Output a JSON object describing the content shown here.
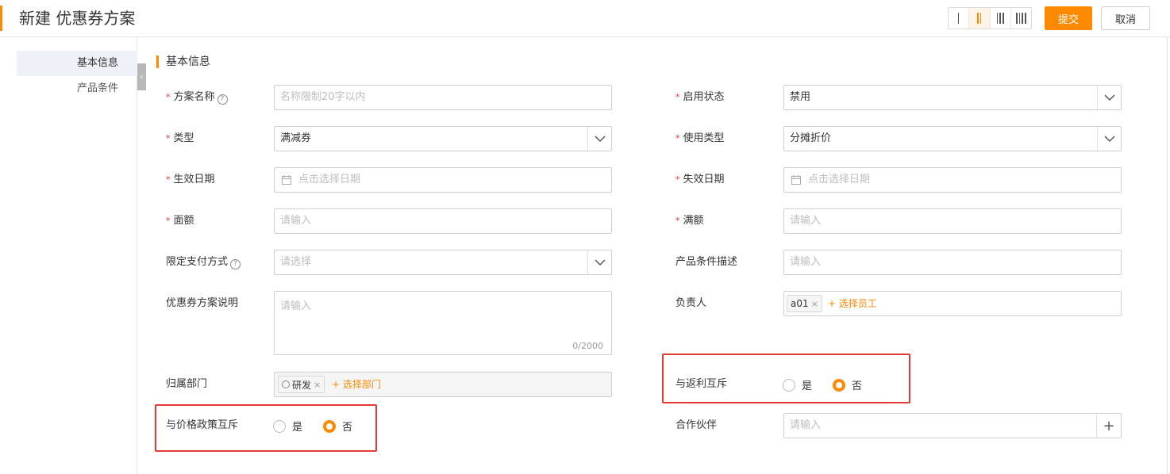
{
  "header": {
    "title": "新建 优惠券方案",
    "submit_label": "提交",
    "cancel_label": "取消",
    "layout_columns_selected": 2
  },
  "sidebar": {
    "items": [
      {
        "label": "基本信息",
        "active": true
      },
      {
        "label": "产品条件",
        "active": false
      }
    ]
  },
  "section": {
    "title": "基本信息"
  },
  "form": {
    "plan_name": {
      "label": "方案名称",
      "placeholder": "名称限制20字以内"
    },
    "status": {
      "label": "启用状态",
      "value": "禁用"
    },
    "type": {
      "label": "类型",
      "value": "满减券"
    },
    "usage_type": {
      "label": "使用类型",
      "value": "分摊折价"
    },
    "start_date": {
      "label": "生效日期",
      "placeholder": "点击选择日期"
    },
    "end_date": {
      "label": "失效日期",
      "placeholder": "点击选择日期"
    },
    "face_value": {
      "label": "面额",
      "placeholder": "请输入"
    },
    "threshold": {
      "label": "满额",
      "placeholder": "请输入"
    },
    "payment_method": {
      "label": "限定支付方式",
      "placeholder": "请选择"
    },
    "product_desc": {
      "label": "产品条件描述",
      "placeholder": "请输入"
    },
    "description": {
      "label": "优惠券方案说明",
      "placeholder": "请输入",
      "count": "0/2000"
    },
    "owner": {
      "label": "负责人",
      "tag": "a01",
      "add_label": "+ 选择员工"
    },
    "department": {
      "label": "归属部门",
      "tag": "研发",
      "add_label": "+ 选择部门"
    },
    "rebate_exclusive": {
      "label": "与返利互斥",
      "yes": "是",
      "no": "否",
      "selected": "否"
    },
    "price_policy_exclusive": {
      "label": "与价格政策互斥",
      "yes": "是",
      "no": "否",
      "selected": "否"
    },
    "partner": {
      "label": "合作伙伴",
      "placeholder": "请输入"
    }
  },
  "colors": {
    "accent": "#ff8a00",
    "highlight": "#e53935"
  }
}
